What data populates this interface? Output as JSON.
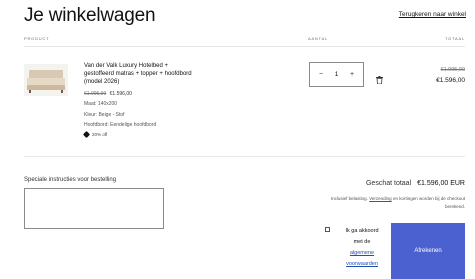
{
  "cart": {
    "title": "Je winkelwagen",
    "continue_link": "Terugkeren naar winkel",
    "columns": {
      "product": "PRODUCT",
      "quantity": "AANTAL",
      "total": "TOTAAL"
    }
  },
  "item": {
    "title": "Van der Valk Luxury Hotelbed + gestoffeerd matras + topper + hoofdbord (model 2026)",
    "price_old": "€1.995,00",
    "price_new": "€1.596,00",
    "size": "Maat: 140x200",
    "color": "Kleur: Beige - Stof",
    "headboard": "Hoofdbord: Eendelige hoofdbord",
    "discount": "20% off",
    "quantity": "1",
    "quantity_minus": "−",
    "quantity_plus": "+",
    "line_total_old": "€1.995,00",
    "line_total_new": "€1.596,00"
  },
  "notes": {
    "label": "Speciale instructies voor bestelling",
    "value": ""
  },
  "summary": {
    "label": "Geschat totaal",
    "amount": "€1.596,00 EUR",
    "tax_note_before": "Inclusief belasting. ",
    "tax_note_link": "Verzending",
    "tax_note_after": " en kortingen worden bij de checkout berekend."
  },
  "agree": {
    "line1": "Ik ga akkoord",
    "line2": "met de",
    "link1": "algemene",
    "link2": "voorwaarden"
  },
  "checkout_button": "Afrekenen",
  "colors": {
    "accent": "#4b61cf",
    "text": "#121212",
    "link": "#1f4fb5"
  },
  "icons": [
    "trash-icon",
    "discount-tag-icon"
  ]
}
